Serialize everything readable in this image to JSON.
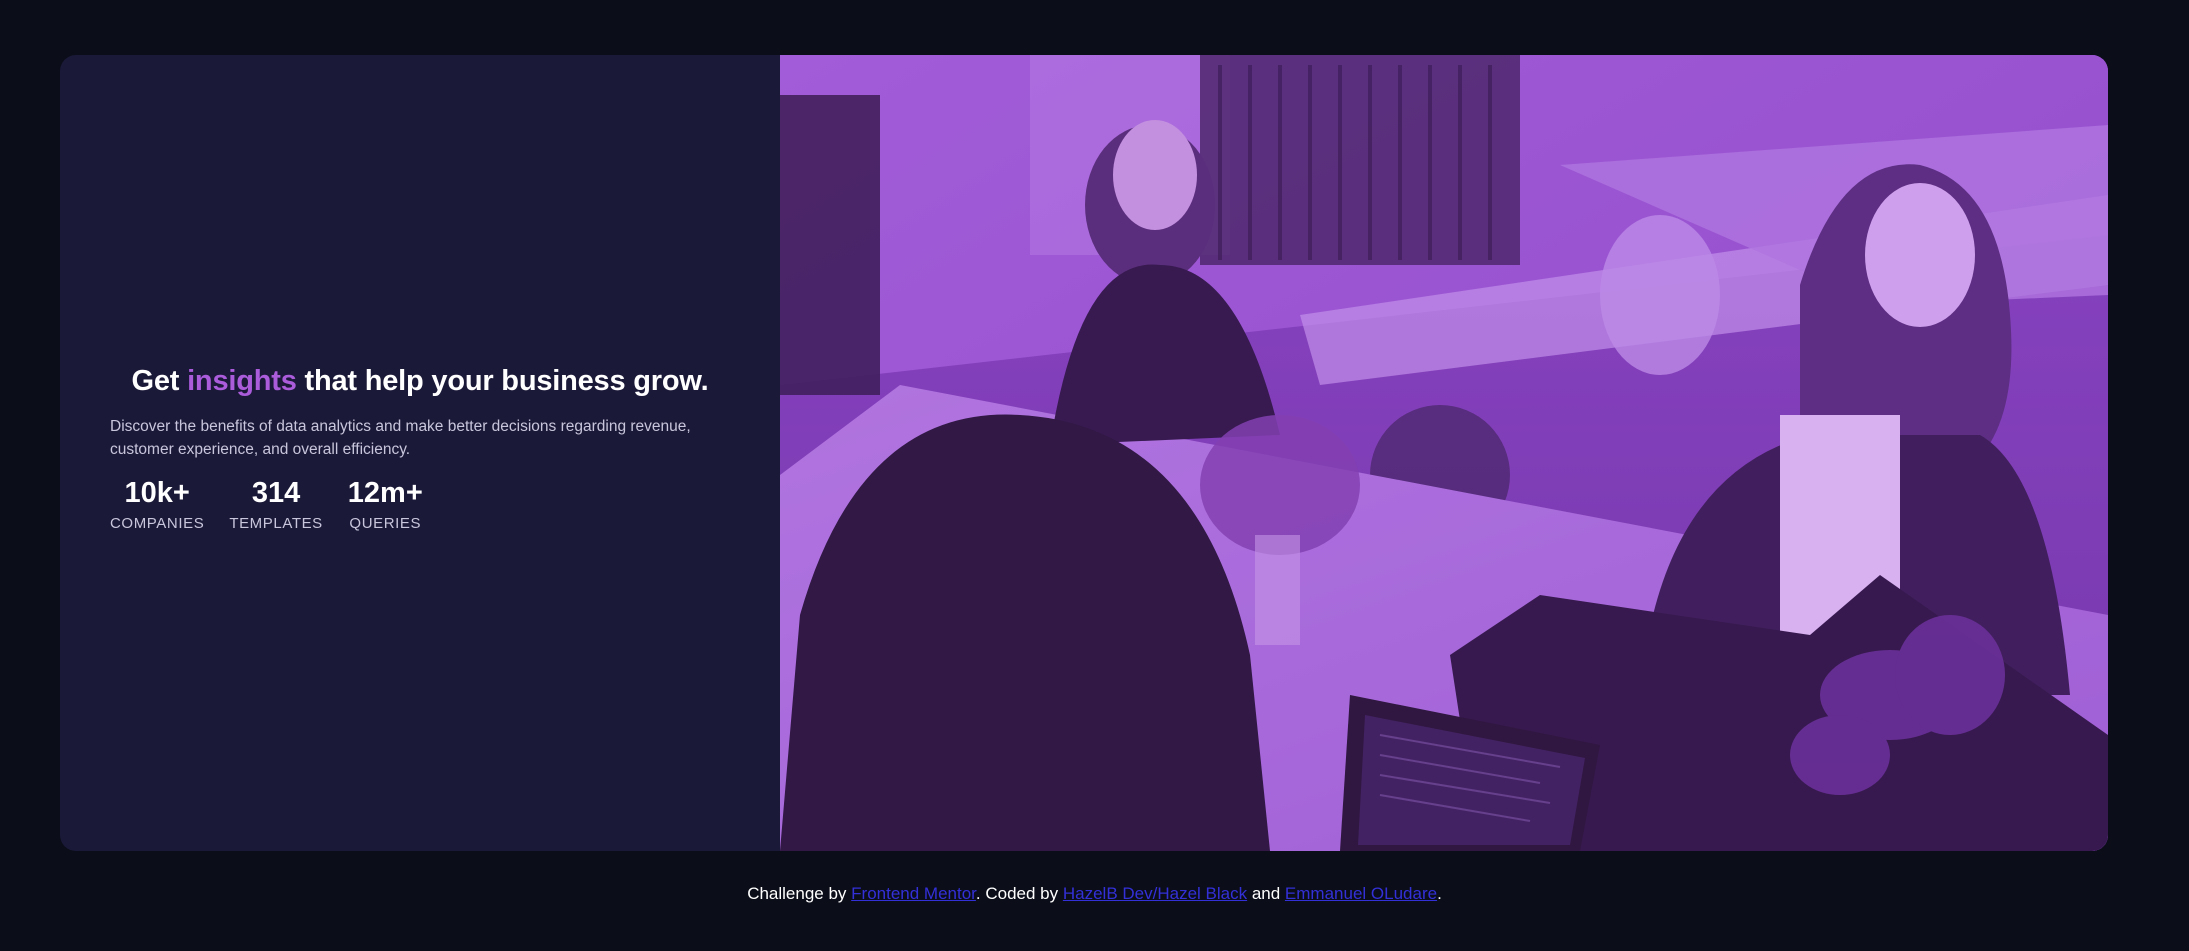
{
  "hero": {
    "headline_before": "Get ",
    "headline_accent": "insights",
    "headline_after": " that help your business grow.",
    "description": "Discover the benefits of data analytics and make better decisions regarding revenue, customer experience, and overall efficiency.",
    "stats": [
      {
        "value": "10k+",
        "label": "COMPANIES"
      },
      {
        "value": "314",
        "label": "TEMPLATES"
      },
      {
        "value": "12m+",
        "label": "QUERIES"
      }
    ]
  },
  "image": {
    "subject": "office-workers-photo",
    "overlay_color": "#aa5cdb"
  },
  "footer": {
    "prefix": "Challenge by ",
    "link1": "Frontend Mentor",
    "mid": ". Coded by ",
    "link2": "HazelB Dev/Hazel Black",
    "and": " and ",
    "link3": "Emmanuel OLudare",
    "suffix": "."
  },
  "colors": {
    "background": "#0b0d19",
    "card": "#1b1938",
    "accent": "#aa5cdb",
    "link": "#3330d8"
  }
}
